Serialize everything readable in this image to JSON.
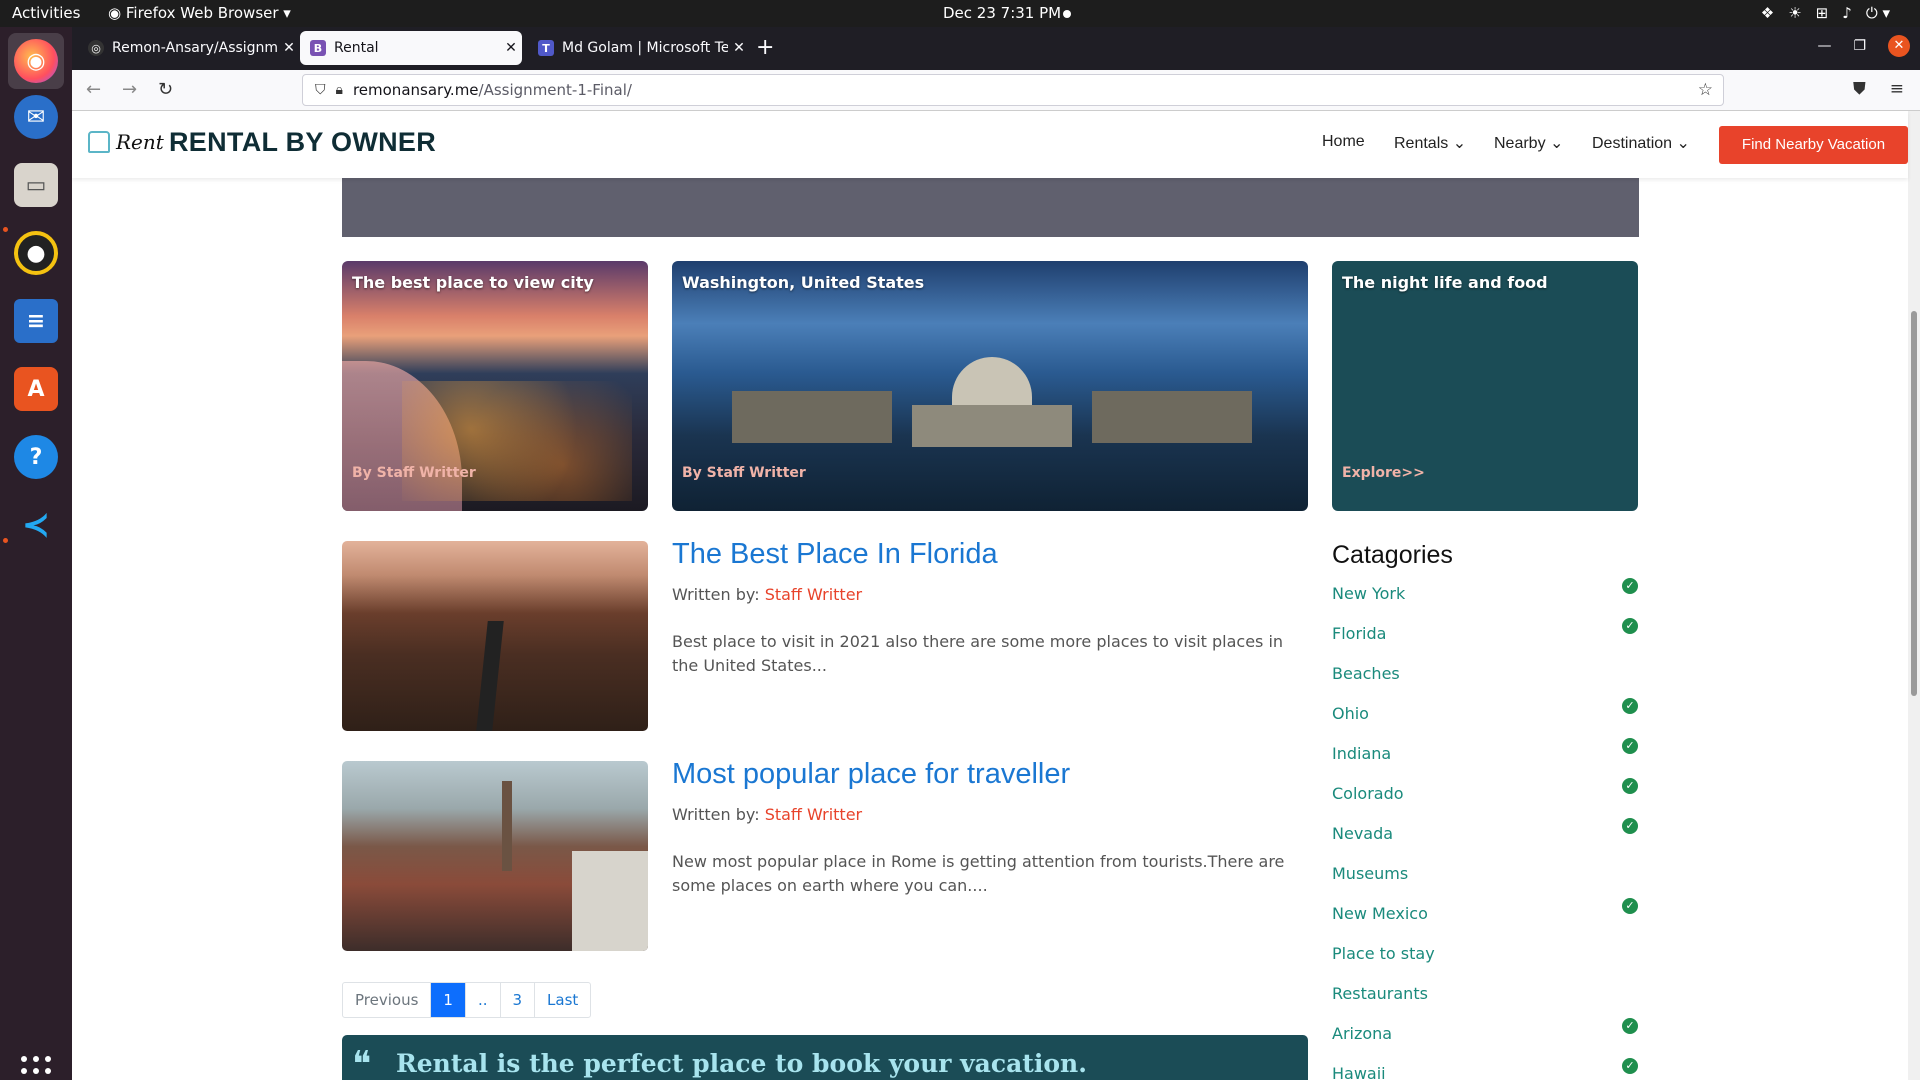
{
  "system": {
    "activities": "Activities",
    "app_name": "Firefox Web Browser",
    "clock": "Dec 23  7:31 PM"
  },
  "browser": {
    "tabs": [
      {
        "label": "Remon-Ansary/Assignme"
      },
      {
        "label": "Rental"
      },
      {
        "label": "Md Golam | Microsoft Tea"
      }
    ],
    "url_host": "remonansary.me",
    "url_path": "/Assignment-1-Final/"
  },
  "site": {
    "logo_text": "Rent",
    "brand": "RENTAL BY OWNER",
    "nav": {
      "home": "Home",
      "rentals": "Rentals",
      "nearby": "Nearby",
      "destination": "Destination",
      "cta": "Find Nearby Vacation"
    },
    "cards": [
      {
        "title": "The best place to view city",
        "footer": "By Staff Writter"
      },
      {
        "title": "Washington, United States",
        "footer": "By Staff Writter"
      },
      {
        "title": "The night life and food",
        "footer": "Explore>>"
      }
    ],
    "posts": [
      {
        "title": "The Best Place In Florida",
        "written_label": "Written by: ",
        "author": "Staff Writter",
        "excerpt": "Best place to visit in 2021 also there are some more places to visit places in the United States..."
      },
      {
        "title": "Most popular place for traveller",
        "written_label": "Written by: ",
        "author": "Staff Writter",
        "excerpt": "New most popular place in Rome is getting attention from tourists.There are some places on earth where you can...."
      }
    ],
    "pagination": {
      "previous": "Previous",
      "current": "1",
      "ellipsis": "..",
      "page3": "3",
      "last": "Last"
    },
    "quote": "Rental is the perfect place to book your vacation.",
    "categories": {
      "title": "Catagories",
      "items": [
        {
          "label": "New York",
          "checked": true
        },
        {
          "label": "Florida",
          "checked": true
        },
        {
          "label": "Beaches",
          "checked": false
        },
        {
          "label": "Ohio",
          "checked": true
        },
        {
          "label": "Indiana",
          "checked": true
        },
        {
          "label": "Colorado",
          "checked": true
        },
        {
          "label": "Nevada",
          "checked": true
        },
        {
          "label": "Museums",
          "checked": false
        },
        {
          "label": "New Mexico",
          "checked": true
        },
        {
          "label": "Place to stay",
          "checked": false
        },
        {
          "label": "Restaurants",
          "checked": false
        },
        {
          "label": "Arizona",
          "checked": true
        },
        {
          "label": "Hawaii",
          "checked": true
        }
      ]
    }
  },
  "colors": {
    "accent": "#e8432b",
    "link": "#1a77d2",
    "teal": "#1b4c56",
    "category": "#1a8a7c"
  }
}
